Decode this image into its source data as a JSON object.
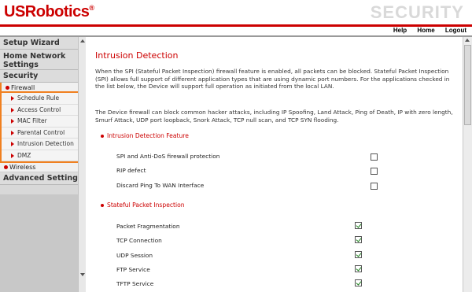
{
  "brand": {
    "logo": "USRobotics",
    "trademark": "®"
  },
  "header": {
    "section_title": "SECURITY"
  },
  "top_links": {
    "help": "Help",
    "home": "Home",
    "logout": "Logout"
  },
  "colors": {
    "accent": "#cc0000",
    "highlight": "#f08020",
    "check": "#1a7f1a"
  },
  "sidebar": {
    "setup_wizard": "Setup Wizard",
    "home_network": "Home Network Settings",
    "security": "Security",
    "firewall": "Firewall",
    "firewall_items": [
      {
        "label": "Schedule Rule"
      },
      {
        "label": "Access Control"
      },
      {
        "label": "MAC Filter"
      },
      {
        "label": "Parental Control"
      },
      {
        "label": "Intrusion Detection"
      },
      {
        "label": "DMZ"
      }
    ],
    "wireless": "Wireless",
    "advanced": "Advanced Settings"
  },
  "main": {
    "title": "Intrusion Detection",
    "para1": "When the SPI (Stateful Packet Inspection) firewall feature is enabled, all packets can be blocked.  Stateful Packet Inspection (SPI) allows full support of different application types that are using dynamic port numbers. For the applications checked in the list below, the Device will support full operation as initiated from the local LAN.",
    "para2": "The Device firewall can block common hacker attacks, including IP Spoofing, Land Attack, Ping of Death, IP with zero length, Smurf Attack, UDP port loopback, Snork Attack, TCP null scan, and TCP SYN flooding.",
    "section1": "Intrusion Detection Feature",
    "options1": [
      {
        "label": "SPI and Anti-DoS firewall protection",
        "checked": false
      },
      {
        "label": "RIP defect",
        "checked": false
      },
      {
        "label": "Discard Ping To WAN Interface",
        "checked": false
      }
    ],
    "section2": "Stateful Packet Inspection",
    "options2": [
      {
        "label": "Packet Fragmentation",
        "checked": true
      },
      {
        "label": "TCP Connection",
        "checked": true
      },
      {
        "label": "UDP Session",
        "checked": true
      },
      {
        "label": "FTP Service",
        "checked": true
      },
      {
        "label": "TFTP  Service",
        "checked": true
      }
    ]
  }
}
